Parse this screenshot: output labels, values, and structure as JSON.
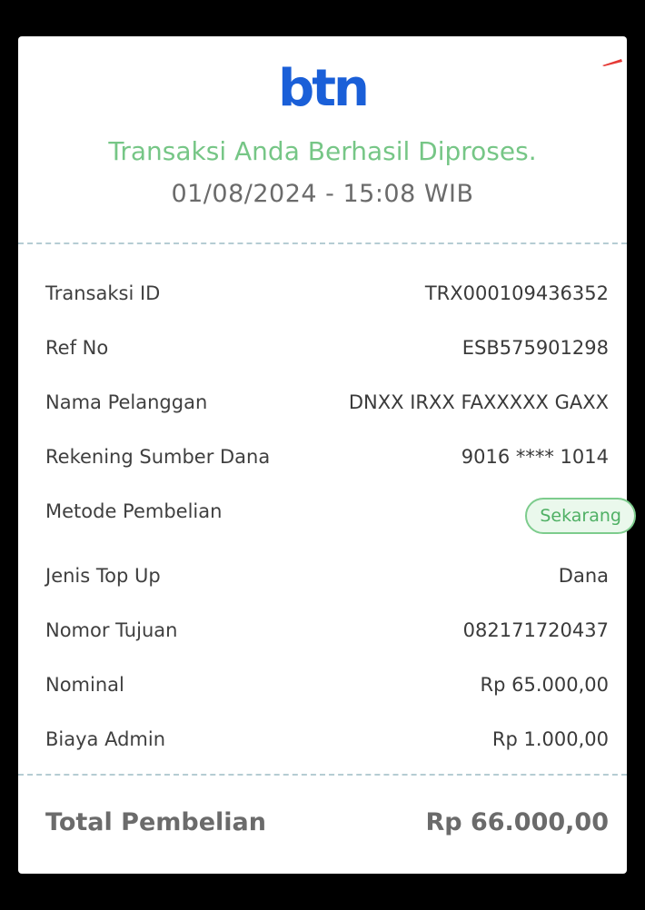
{
  "brand": {
    "logo_text": "btn",
    "logo_color": "#1a5fd8",
    "accent_color": "#e53935"
  },
  "status": {
    "title": "Transaksi Anda Berhasil Diproses.",
    "timestamp": "01/08/2024 - 15:08 WIB",
    "title_color": "#76c686"
  },
  "details": [
    {
      "label": "Transaksi ID",
      "value": "TRX000109436352"
    },
    {
      "label": "Ref No",
      "value": "ESB575901298"
    },
    {
      "label": "Nama Pelanggan",
      "value": "DNXX IRXX FAXXXXX GAXX"
    },
    {
      "label": "Rekening Sumber Dana",
      "value": "9016 **** 1014"
    },
    {
      "label": "Metode Pembelian",
      "value": "Sekarang"
    },
    {
      "label": "Jenis Top Up",
      "value": "Dana"
    },
    {
      "label": "Nomor Tujuan",
      "value": "082171720437"
    },
    {
      "label": "Nominal",
      "value": "Rp 65.000,00"
    },
    {
      "label": "Biaya Admin",
      "value": "Rp 1.000,00"
    }
  ],
  "total": {
    "label": "Total Pembelian",
    "value": "Rp 66.000,00"
  }
}
